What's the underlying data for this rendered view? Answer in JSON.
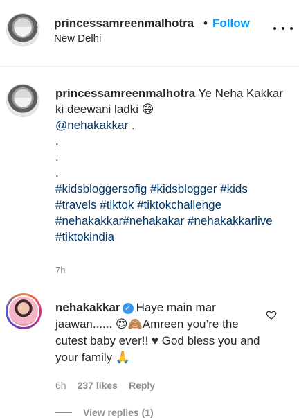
{
  "post": {
    "username": "princessamreenmalhotra",
    "separator": "•",
    "follow_label": "Follow",
    "location": "New Delhi"
  },
  "caption": {
    "username": "princessamreenmalhotra",
    "text_line1": "Ye Neha Kakkar ki deewani ladki 😄",
    "mention": "@nehakakkar",
    "mention_suffix": " .",
    "dots": [
      ".",
      ".",
      "."
    ],
    "hashtags": "#kidsbloggersofig #kidsblogger #kids #travels #tiktok #tiktokchallenge #nehakakkar#nehakakar #nehakakkarlive #tiktokindia",
    "timestamp": "7h"
  },
  "comment": {
    "username": "nehakakkar",
    "verified_mark": "✓",
    "text": "Haye main mar jaawan...... 😍🙈Amreen you’re the cutest baby ever!! ♥ God bless you and your family 🙏",
    "time": "6h",
    "likes": "237 likes",
    "reply_label": "Reply"
  },
  "replies": {
    "label": "View replies (1)"
  },
  "icons": {
    "more": "more-options-icon",
    "heart": "heart-outline-icon",
    "verified": "verified-badge-icon"
  },
  "colors": {
    "follow": "#0095f6",
    "link": "#00376b",
    "secondary_text": "#8e8e8e"
  }
}
